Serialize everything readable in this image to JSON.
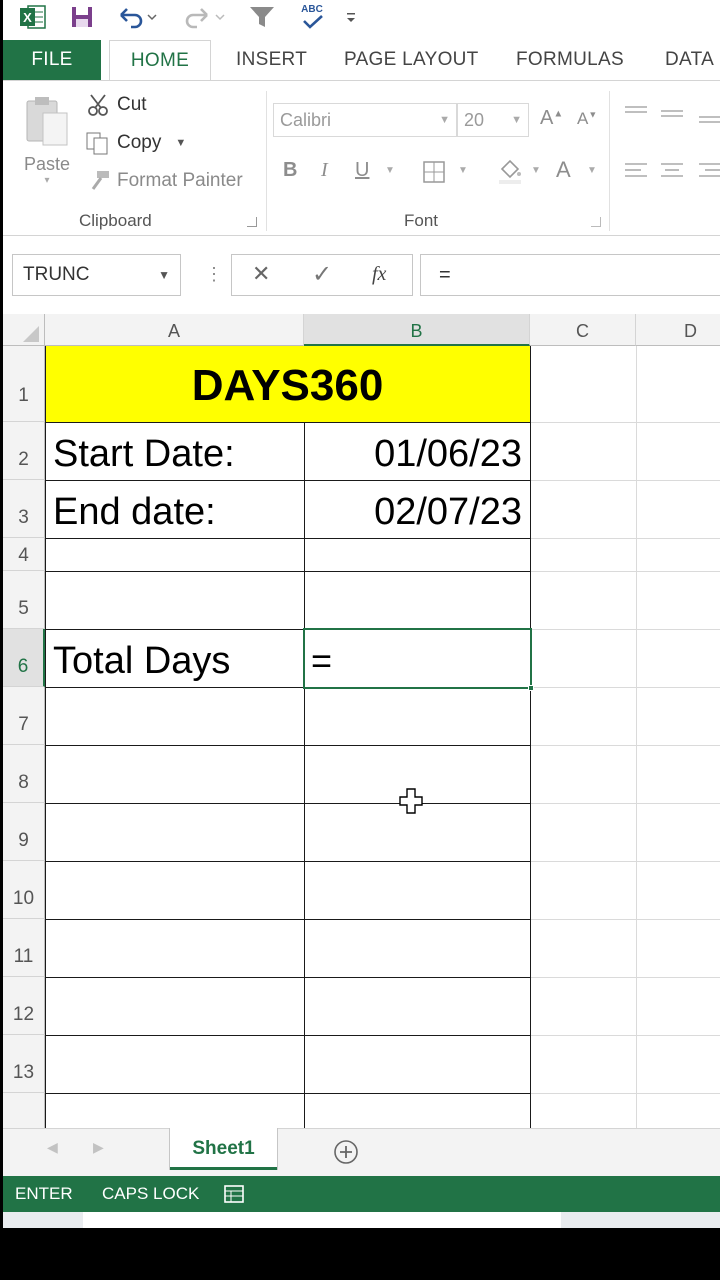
{
  "qat": {
    "icons": [
      "excel-logo",
      "save",
      "undo",
      "redo",
      "filter",
      "spelling-abc",
      "customize"
    ],
    "spell_label": "ABC",
    "excel_letter": "X"
  },
  "tabs": {
    "file": "FILE",
    "home": "HOME",
    "insert": "INSERT",
    "page_layout": "PAGE LAYOUT",
    "formulas": "FORMULAS",
    "data": "DATA"
  },
  "clipboard": {
    "paste": "Paste",
    "cut": "Cut",
    "copy": "Copy",
    "format_painter": "Format Painter",
    "group_label": "Clipboard"
  },
  "font": {
    "name": "Calibri",
    "size": "20",
    "grow": "A",
    "shrink": "A",
    "bold": "B",
    "italic": "I",
    "underline": "U",
    "font_color": "A",
    "group_label": "Font"
  },
  "formula_bar": {
    "name_box": "TRUNC",
    "cancel": "✕",
    "enter": "✓",
    "fx": "fx",
    "content": "="
  },
  "grid": {
    "columns": [
      "A",
      "B",
      "C",
      "D"
    ],
    "rows": [
      "1",
      "2",
      "3",
      "4",
      "5",
      "6",
      "7",
      "8",
      "9",
      "10",
      "11",
      "12",
      "13"
    ],
    "title": "DAYS360",
    "title_fill": "#ffff00",
    "a2": "Start Date:",
    "b2": "01/06/23",
    "a3": "End date:",
    "b3": "02/07/23",
    "a6": "Total Days",
    "b6": "=",
    "active_cell": "B6",
    "accent": "#217346"
  },
  "sheets": {
    "tab": "Sheet1"
  },
  "status": {
    "mode": "ENTER",
    "caps": "CAPS LOCK"
  }
}
